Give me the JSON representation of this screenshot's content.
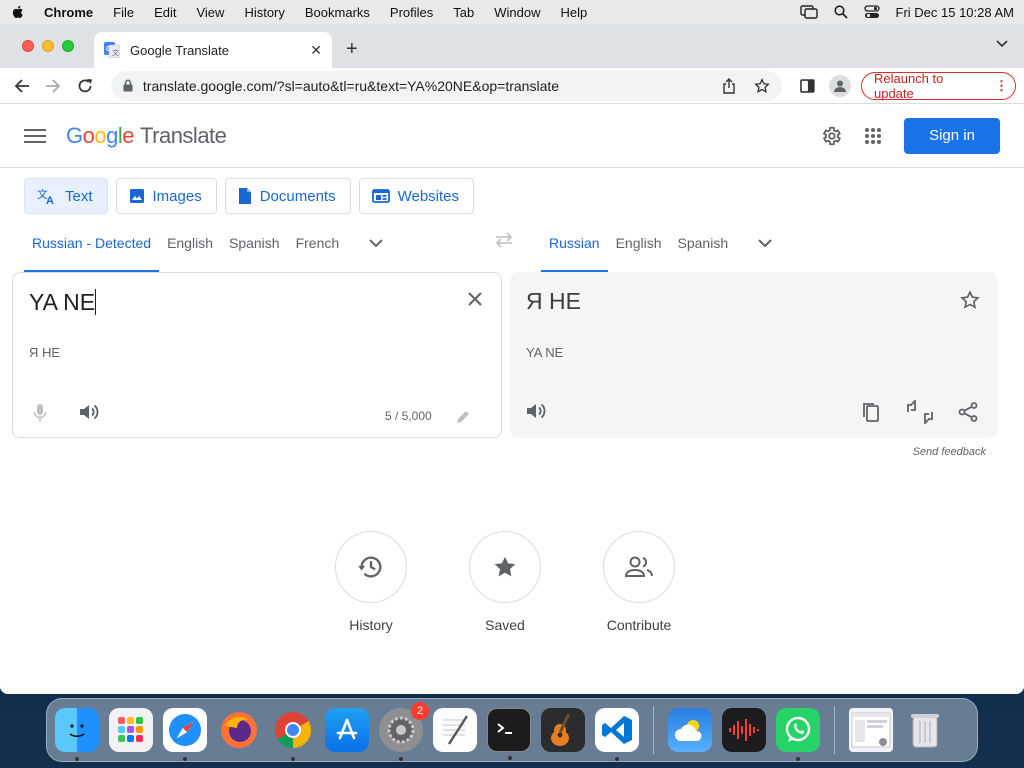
{
  "menubar": {
    "app_name": "Chrome",
    "menus": [
      "File",
      "Edit",
      "View",
      "History",
      "Bookmarks",
      "Profiles",
      "Tab",
      "Window",
      "Help"
    ],
    "clock": "Fri Dec 15  10:28 AM"
  },
  "browser": {
    "tab_title": "Google Translate",
    "url": "translate.google.com/?sl=auto&tl=ru&text=YA%20NE&op=translate",
    "relaunch_label": "Relaunch to update"
  },
  "header": {
    "logo_letters": [
      "G",
      "o",
      "o",
      "g",
      "l",
      "e"
    ],
    "product": "Translate",
    "sign_in": "Sign in"
  },
  "modes": [
    {
      "label": "Text",
      "icon": "translate-icon",
      "active": true
    },
    {
      "label": "Images",
      "icon": "image-icon",
      "active": false
    },
    {
      "label": "Documents",
      "icon": "document-icon",
      "active": false
    },
    {
      "label": "Websites",
      "icon": "website-icon",
      "active": false
    }
  ],
  "source_languages": [
    "Russian - Detected",
    "English",
    "Spanish",
    "French"
  ],
  "target_languages": [
    "Russian",
    "English",
    "Spanish"
  ],
  "source": {
    "text": "YA NE",
    "transliteration": "Я НЕ",
    "char_count": "5 / 5,000"
  },
  "target": {
    "text": "Я НЕ",
    "transliteration": "YA NE"
  },
  "feedback": "Send feedback",
  "actions": [
    {
      "label": "History",
      "icon": "history-icon"
    },
    {
      "label": "Saved",
      "icon": "star-icon"
    },
    {
      "label": "Contribute",
      "icon": "people-icon"
    }
  ],
  "dock": {
    "settings_badge": "2",
    "apps": [
      "Finder",
      "Launchpad",
      "Safari",
      "Firefox",
      "Chrome",
      "App Store",
      "System Preferences",
      "TextEdit",
      "Terminal",
      "GarageBand",
      "Visual Studio Code",
      "Weather",
      "Voice Memos",
      "WhatsApp"
    ]
  }
}
